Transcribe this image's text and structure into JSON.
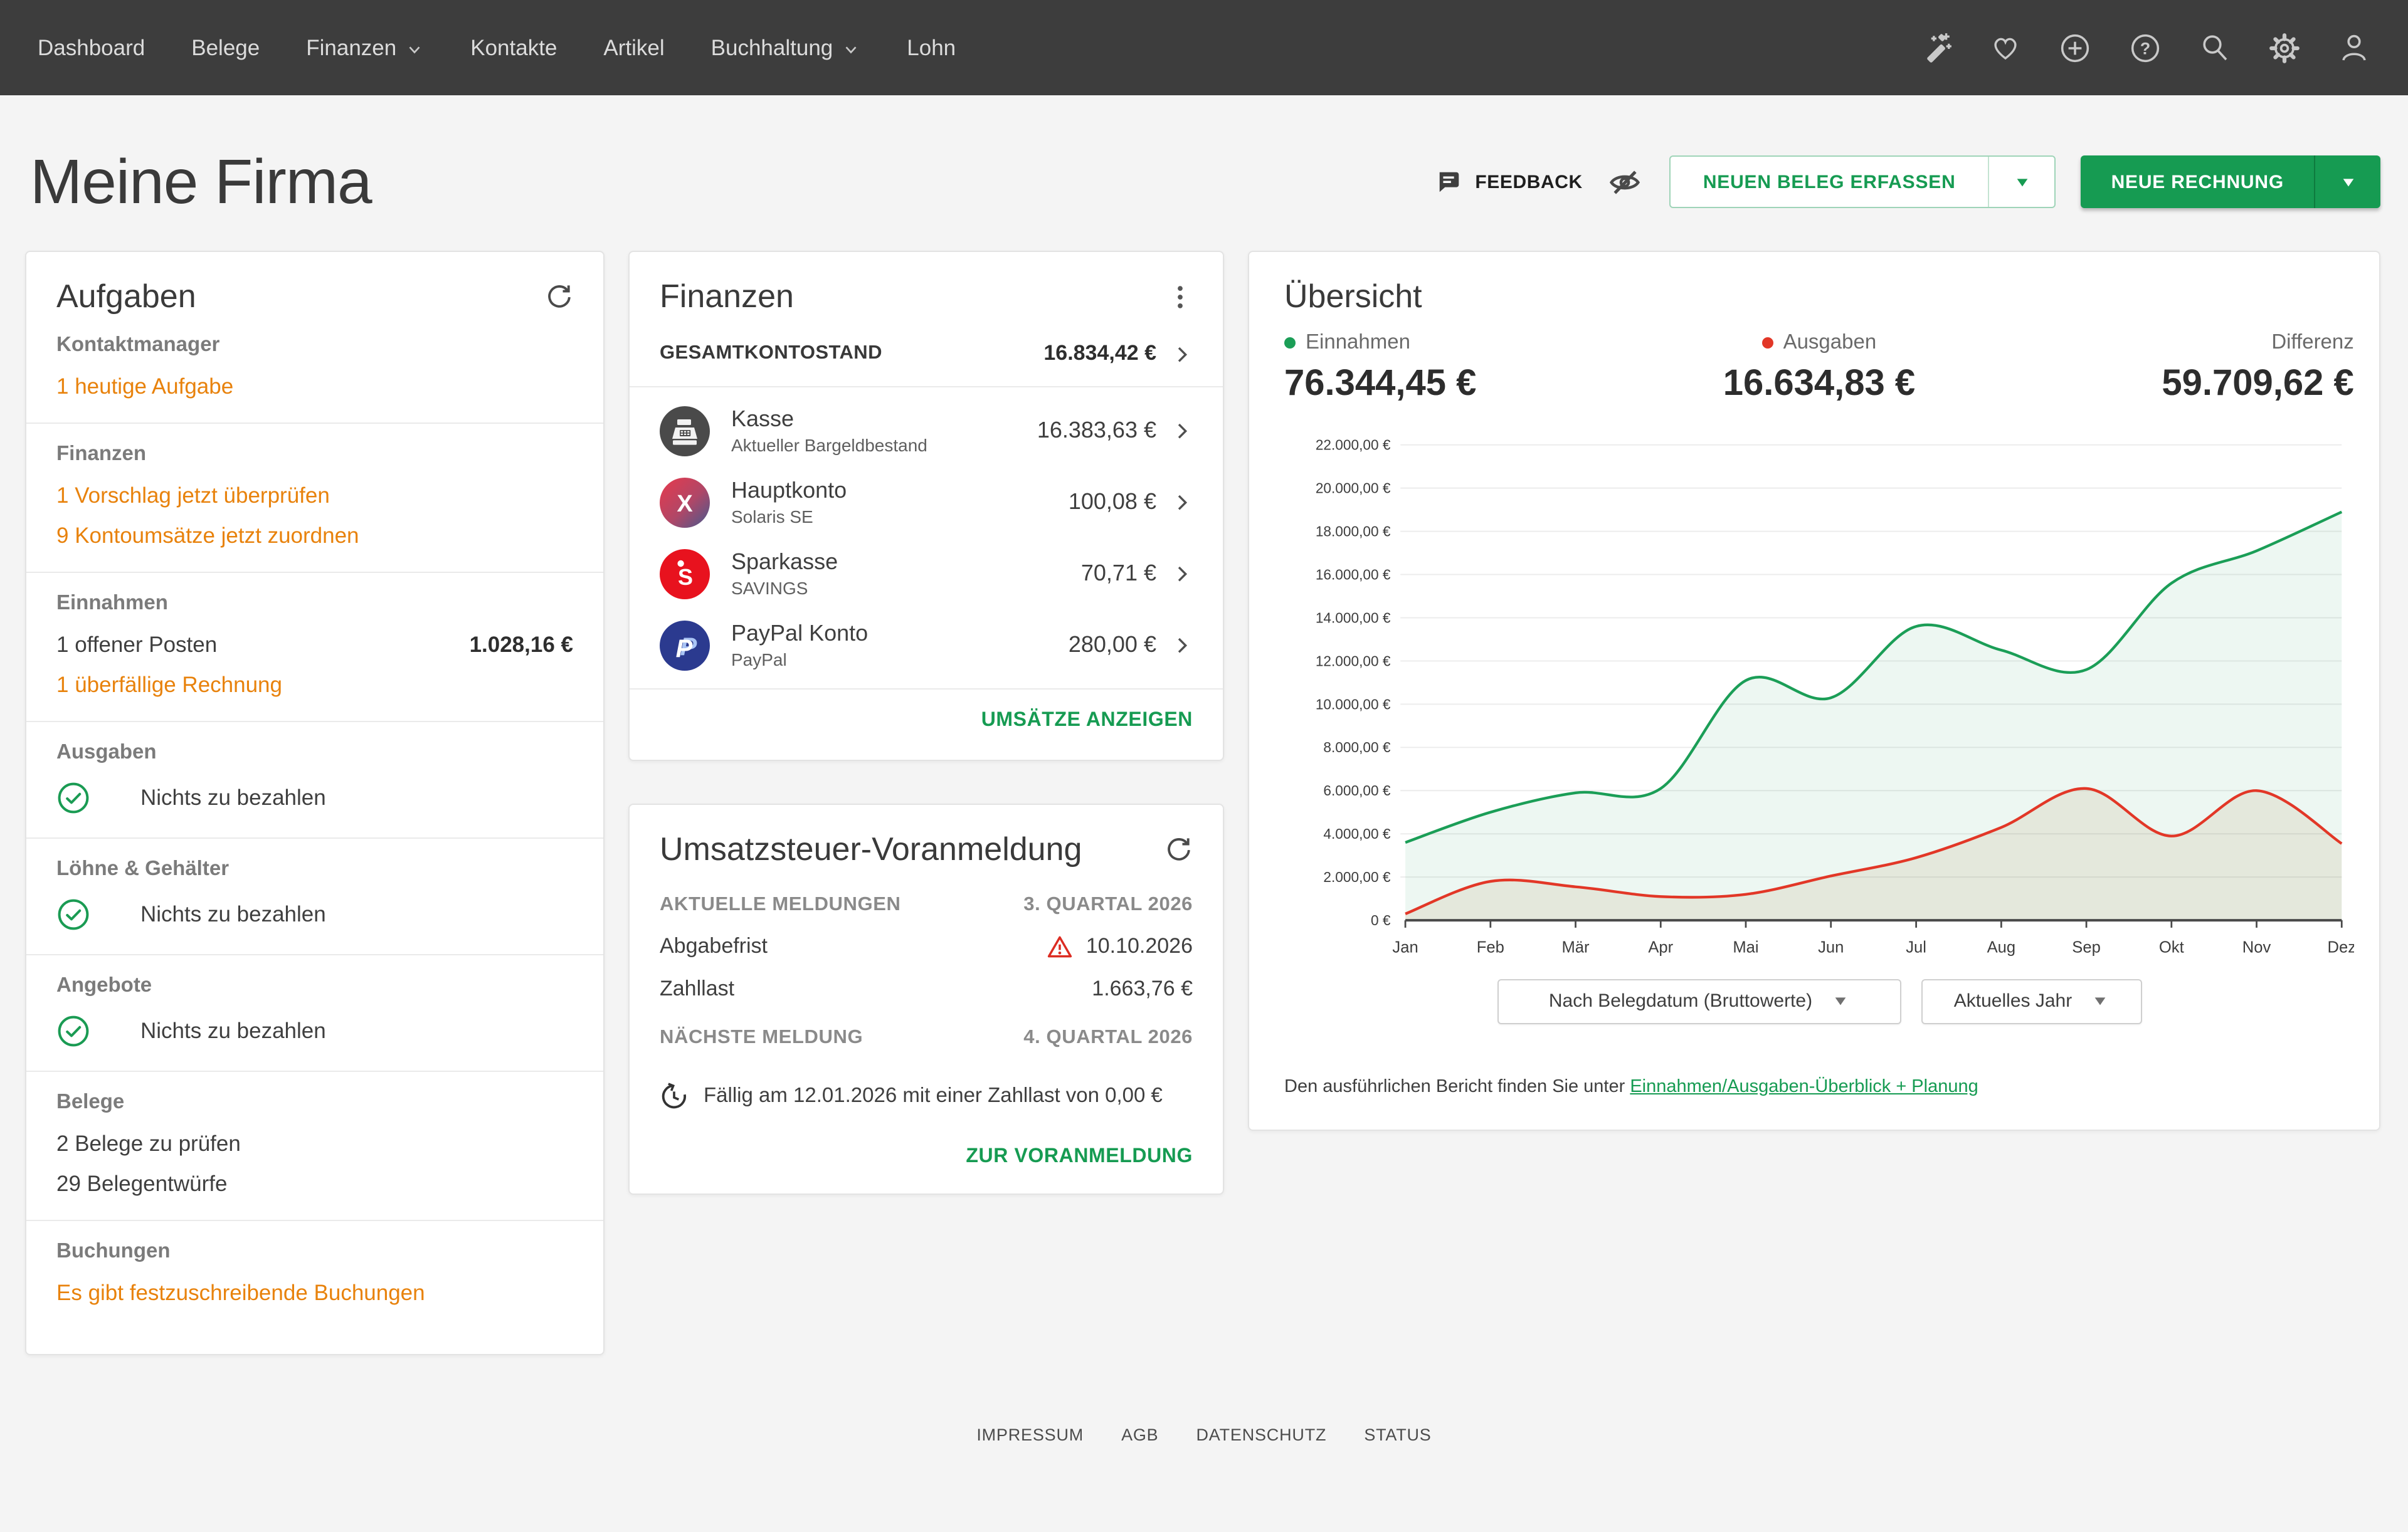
{
  "colors": {
    "brand_green": "#169b52",
    "orange": "#e8820c",
    "nav_bg": "#3d3d3d",
    "page_bg": "#f4f4f4",
    "line_green": "#1b9e57",
    "line_red": "#e23727",
    "warning_red": "#dc2c22",
    "green_fill": "rgba(27,158,87,0.08)",
    "red_fill": "rgba(170,135,80,0.13)"
  },
  "nav": {
    "items": [
      {
        "label": "Dashboard",
        "has_dropdown": false
      },
      {
        "label": "Belege",
        "has_dropdown": false
      },
      {
        "label": "Finanzen",
        "has_dropdown": true
      },
      {
        "label": "Kontakte",
        "has_dropdown": false
      },
      {
        "label": "Artikel",
        "has_dropdown": false
      },
      {
        "label": "Buchhaltung",
        "has_dropdown": true
      },
      {
        "label": "Lohn",
        "has_dropdown": false
      }
    ],
    "icons": [
      "wand",
      "heart",
      "plus-circle",
      "question-circle",
      "search",
      "gear",
      "user"
    ]
  },
  "header": {
    "title": "Meine Firma",
    "feedback_label": "FEEDBACK",
    "buttons": [
      {
        "label": "NEUEN BELEG ERFASSEN",
        "style": "outline"
      },
      {
        "label": "NEUE RECHNUNG",
        "style": "solid"
      }
    ]
  },
  "tasks_card": {
    "title": "Aufgaben",
    "sections": [
      {
        "heading": "Kontaktmanager",
        "items": [
          {
            "type": "link",
            "text": "1 heutige Aufgabe"
          }
        ]
      },
      {
        "heading": "Finanzen",
        "items": [
          {
            "type": "link",
            "text": "1 Vorschlag jetzt überprüfen"
          },
          {
            "type": "link",
            "text": "9 Kontoumsätze jetzt zuordnen"
          }
        ]
      },
      {
        "heading": "Einnahmen",
        "items": [
          {
            "type": "text-value",
            "text": "1 offener Posten",
            "value": "1.028,16 €"
          },
          {
            "type": "link",
            "text": "1 überfällige Rechnung"
          }
        ]
      },
      {
        "heading": "Ausgaben",
        "items": [
          {
            "type": "check",
            "text": "Nichts zu bezahlen"
          }
        ]
      },
      {
        "heading": "Löhne & Gehälter",
        "items": [
          {
            "type": "check",
            "text": "Nichts zu bezahlen"
          }
        ]
      },
      {
        "heading": "Angebote",
        "items": [
          {
            "type": "check",
            "text": "Nichts zu bezahlen"
          }
        ]
      },
      {
        "heading": "Belege",
        "items": [
          {
            "type": "text",
            "text": "2 Belege zu prüfen"
          },
          {
            "type": "text",
            "text": "29 Belegentwürfe"
          }
        ]
      },
      {
        "heading": "Buchungen",
        "items": [
          {
            "type": "link",
            "text": "Es gibt festzuschreibende Buchungen"
          }
        ]
      }
    ]
  },
  "finance_card": {
    "title": "Finanzen",
    "total_label": "GESAMTKONTOSTAND",
    "total_value": "16.834,42 €",
    "accounts": [
      {
        "name": "Kasse",
        "subtitle": "Aktueller Bargeldbestand",
        "value": "16.383,63 €",
        "icon": "kasse"
      },
      {
        "name": "Hauptkonto",
        "subtitle": "Solaris SE",
        "value": "100,08 €",
        "icon": "hauptkonto"
      },
      {
        "name": "Sparkasse",
        "subtitle": "SAVINGS",
        "value": "70,71 €",
        "icon": "sparkasse"
      },
      {
        "name": "PayPal Konto",
        "subtitle": "PayPal",
        "value": "280,00 €",
        "icon": "paypal"
      }
    ],
    "footer_link": "UMSÄTZE ANZEIGEN"
  },
  "vat_card": {
    "title": "Umsatzsteuer-Voranmeldung",
    "current_label": "AKTUELLE MELDUNGEN",
    "current_period": "3. QUARTAL 2026",
    "rows": [
      {
        "label": "Abgabefrist",
        "value": "10.10.2026",
        "warning": true
      },
      {
        "label": "Zahllast",
        "value": "1.663,76 €",
        "warning": false
      }
    ],
    "next_label": "NÄCHSTE MELDUNG",
    "next_period": "4. QUARTAL 2026",
    "due_note": "Fällig am 12.01.2026 mit einer Zahllast von 0,00 €",
    "footer_link": "ZUR VORANMELDUNG"
  },
  "overview_card": {
    "title": "Übersicht",
    "stats": [
      {
        "label": "Einnahmen",
        "value": "76.344,45 €",
        "dot": "#1b9e57",
        "align": "l"
      },
      {
        "label": "Ausgaben",
        "value": "16.634,83 €",
        "dot": "#e23727",
        "align": "c"
      },
      {
        "label": "Differenz",
        "value": "59.709,62 €",
        "dot": null,
        "align": "r"
      }
    ],
    "filters": [
      "Nach Belegdatum (Bruttowerte)",
      "Aktuelles Jahr"
    ],
    "report_note": "Den ausführlichen Bericht finden Sie unter ",
    "report_link": "Einnahmen/Ausgaben-Überblick + Planung"
  },
  "chart_data": {
    "type": "area",
    "x": [
      "Jan",
      "Feb",
      "Mär",
      "Apr",
      "Mai",
      "Jun",
      "Jul",
      "Aug",
      "Sep",
      "Okt",
      "Nov",
      "Dez"
    ],
    "series": [
      {
        "name": "Einnahmen",
        "color": "#1b9e57",
        "fill": "rgba(27,158,87,0.08)",
        "values": [
          3600,
          5000,
          5900,
          6100,
          11100,
          10300,
          13600,
          12500,
          11600,
          15600,
          17100,
          18900
        ]
      },
      {
        "name": "Ausgaben",
        "color": "#e23727",
        "fill": "rgba(170,135,80,0.13)",
        "values": [
          300,
          1800,
          1550,
          1100,
          1200,
          2050,
          2900,
          4300,
          6100,
          3900,
          6000,
          3550
        ]
      }
    ],
    "ylim": [
      0,
      22000
    ],
    "ytick_step": 2000,
    "ytick_labels": [
      "0 €",
      "2.000,00 €",
      "4.000,00 €",
      "6.000,00 €",
      "8.000,00 €",
      "10.000,00 €",
      "12.000,00 €",
      "14.000,00 €",
      "16.000,00 €",
      "18.000,00 €",
      "20.000,00 €",
      "22.000,00 €"
    ],
    "grid": true,
    "legend_position": "none"
  },
  "footer": {
    "links": [
      "IMPRESSUM",
      "AGB",
      "DATENSCHUTZ",
      "STATUS"
    ]
  }
}
